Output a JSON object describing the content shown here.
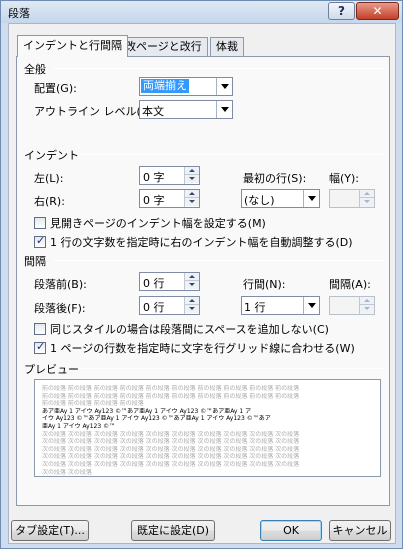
{
  "window": {
    "title": "段落",
    "help": "?",
    "close": "✕"
  },
  "tabs": [
    {
      "label": "インデントと行間隔"
    },
    {
      "label": "改ページと改行"
    },
    {
      "label": "体裁"
    }
  ],
  "general": {
    "title": "全般",
    "alignment_label": "配置(G):",
    "alignment_value": "両端揃え",
    "outline_label": "アウトライン レベル(O):",
    "outline_value": "本文"
  },
  "indent": {
    "title": "インデント",
    "left_label": "左(L):",
    "left_value": "0 字",
    "right_label": "右(R):",
    "right_value": "0 字",
    "first_line_label": "最初の行(S):",
    "first_line_value": "(なし)",
    "width_label": "幅(Y):",
    "width_value": "",
    "mirror_label": "見開きページのインデント幅を設定する(M)",
    "mirror_checked": false,
    "auto_adjust_label": "1 行の文字数を指定時に右のインデント幅を自動調整する(D)",
    "auto_adjust_checked": true
  },
  "spacing": {
    "title": "間隔",
    "before_label": "段落前(B):",
    "before_value": "0 行",
    "after_label": "段落後(F):",
    "after_value": "0 行",
    "line_spacing_label": "行間(N):",
    "line_spacing_value": "1 行",
    "at_label": "間隔(A):",
    "at_value": "",
    "no_space_label": "同じスタイルの場合は段落間にスペースを追加しない(C)",
    "no_space_checked": false,
    "snap_grid_label": "1 ページの行数を指定時に文字を行グリッド線に合わせる(W)",
    "snap_grid_checked": true
  },
  "preview": {
    "title": "プレビュー",
    "lines_before": [
      "前の段落 前の段落 前の段落 前の段落 前の段落 前の段落 前の段落 前の段落 前の段落 前の段落",
      "前の段落 前の段落 前の段落 前の段落 前の段落 前の段落 前の段落 前の段落 前の段落 前の段落",
      "前の段落 前の段落 前の段落 前の段落"
    ],
    "lines_sample": [
      "あア亜Ay 1 アイウ Ay123 ©™あア亜Ay 1 アイウ Ay123 ©™あア亜Ay 1 ア",
      "イウ Ay123 ©™あア亜Ay 1 アイウ Ay123 ©™あア亜Ay 1 アイウ Ay123 ©™あア",
      "亜Ay 1 アイウ Ay123 ©™"
    ],
    "lines_after": [
      "次の段落 次の段落 次の段落 次の段落 次の段落 次の段落 次の段落 次の段落 次の段落 次の段落",
      "次の段落 次の段落 次の段落 次の段落 次の段落 次の段落 次の段落 次の段落 次の段落 次の段落",
      "次の段落 次の段落 次の段落 次の段落 次の段落 次の段落 次の段落 次の段落 次の段落 次の段落",
      "次の段落 次の段落 次の段落 次の段落 次の段落 次の段落 次の段落 次の段落 次の段落 次の段落",
      "次の段落 次の段落 次の段落 次の段落 次の段落 次の段落 次の段落 次の段落 次の段落 次の段落",
      "次の段落 次の段落"
    ]
  },
  "buttons": {
    "tabs": "タブ設定(T)...",
    "set_default": "既定に設定(D)",
    "ok": "OK",
    "cancel": "キャンセル"
  }
}
